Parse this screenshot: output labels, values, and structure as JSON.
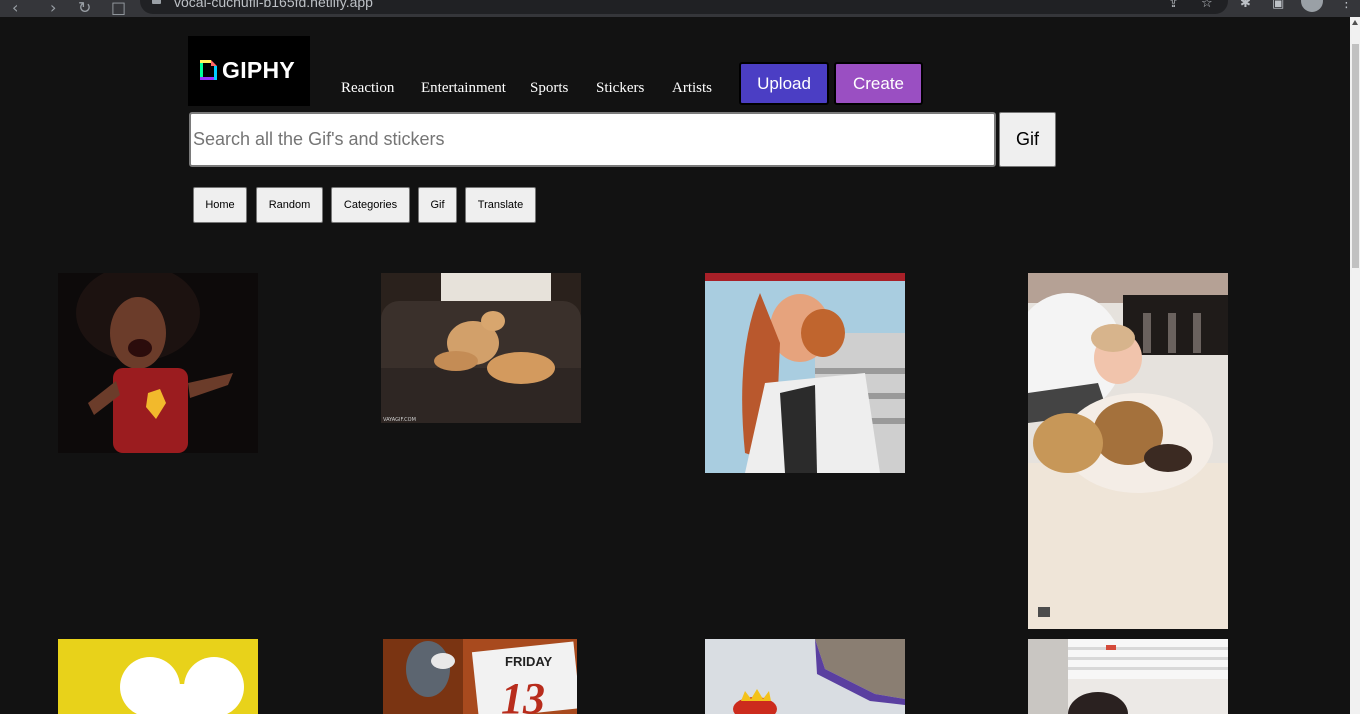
{
  "browser": {
    "url": "vocal-cuchufli-b165fd.netlify.app"
  },
  "header": {
    "logo_text": "GIPHY",
    "nav": [
      {
        "label": "Reaction"
      },
      {
        "label": "Entertainment"
      },
      {
        "label": "Sports"
      },
      {
        "label": "Stickers"
      },
      {
        "label": "Artists"
      }
    ],
    "upload_label": "Upload",
    "create_label": "Create"
  },
  "search": {
    "placeholder": "Search all the Gif's and stickers",
    "value": "",
    "button_label": "Gif"
  },
  "filters": [
    {
      "label": "Home"
    },
    {
      "label": "Random"
    },
    {
      "label": "Categories"
    },
    {
      "label": "Gif"
    },
    {
      "label": "Translate"
    }
  ],
  "colors": {
    "background": "#121212",
    "upload": "#4b3ec4",
    "create": "#9a4fc2"
  },
  "gifs": [
    {
      "subject": "athlete-cheering"
    },
    {
      "subject": "cats-on-sofa",
      "watermark": "VAYAGIF.COM"
    },
    {
      "subject": "bearded-man"
    },
    {
      "subject": "girl-with-puppy"
    },
    {
      "subject": "white-heart"
    },
    {
      "subject": "friday-13-cartoon",
      "caption_day": "FRIDAY",
      "caption_num": "13"
    },
    {
      "subject": "cartoon-crown"
    },
    {
      "subject": "person-indoors"
    }
  ]
}
